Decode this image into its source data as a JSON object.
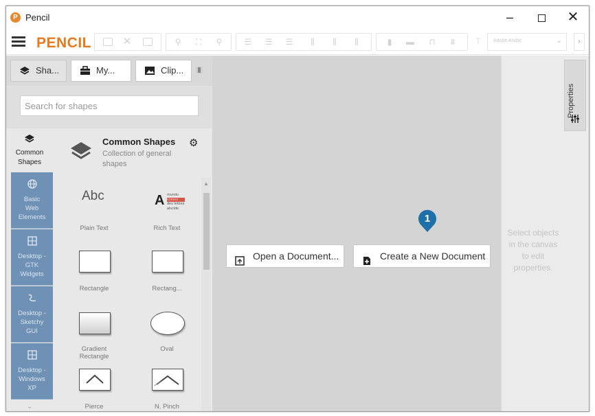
{
  "window": {
    "title": "Pencil",
    "logo_glyph": "P",
    "minimize": "–",
    "close": "✕"
  },
  "toolbar": {
    "brand": "PENCIL",
    "font_value": "Adobe Arabic",
    "more": "›"
  },
  "sidebar": {
    "tabs": [
      {
        "label": "Sha...",
        "icon": "layers-icon"
      },
      {
        "label": "My...",
        "icon": "briefcase-icon"
      },
      {
        "label": "Clip...",
        "icon": "image-icon"
      }
    ],
    "search_placeholder": "Search for shapes",
    "current_collection": {
      "label_line1": "Common",
      "label_line2": "Shapes"
    },
    "collections": [
      {
        "lines": [
          "Basic",
          "Web",
          "Elements"
        ],
        "icon": "globe-icon"
      },
      {
        "lines": [
          "Desktop -",
          "GTK",
          "Widgets"
        ],
        "icon": "grid-icon"
      },
      {
        "lines": [
          "Desktop -",
          "Sketchy",
          "GUI"
        ],
        "icon": "squiggle-icon"
      },
      {
        "lines": [
          "Desktop -",
          "Windows",
          "XP"
        ],
        "icon": "grid-icon"
      }
    ],
    "collection_more": "⌄",
    "header": {
      "title": "Common Shapes",
      "description": "Collection of general shapes"
    },
    "shapes": [
      {
        "label": "Plain Text",
        "preview": "Abc"
      },
      {
        "label": "Rich Text",
        "preview": "A"
      },
      {
        "label": "Rectangle"
      },
      {
        "label": "Rectang..."
      },
      {
        "label_line1": "Gradient",
        "label_line2": "Rectangle"
      },
      {
        "label": "Oval"
      },
      {
        "label": "Pierce"
      },
      {
        "label": "N. Pinch"
      }
    ],
    "richtext_lines": [
      "mundu",
      "comes",
      "des lettres",
      "alscide"
    ]
  },
  "canvas": {
    "open_button": "Open a Document...",
    "new_button": "Create a New Document",
    "marker_number": "1"
  },
  "properties": {
    "tab_label": "Properties",
    "hint": "Select objects in the canvas to edit properties."
  },
  "colors": {
    "brand": "#e87a1e",
    "collection_bg": "#6f91b6",
    "marker": "#1f6fa8",
    "canvas_bg": "#d4d4d4"
  }
}
